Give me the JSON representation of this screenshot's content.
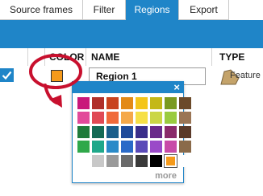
{
  "tabs": [
    {
      "label": "Source frames",
      "active": false
    },
    {
      "label": "Filter",
      "active": false
    },
    {
      "label": "Regions",
      "active": true
    },
    {
      "label": "Export",
      "active": false
    }
  ],
  "grid": {
    "columns": {
      "color": "COLOR",
      "name": "NAME",
      "type": "TYPE"
    },
    "rows": [
      {
        "checked": true,
        "color": "#f59a1b",
        "name": "Region 1",
        "type": "Feature",
        "type_icon": "feature-shape-icon"
      }
    ]
  },
  "color_picker": {
    "close_label": "×",
    "more_label": "more",
    "selected_color": "#f59a1b",
    "colors": [
      "#c9177a",
      "#b0302a",
      "#c8431f",
      "#e38a17",
      "#f4c51a",
      "#c4b817",
      "#7a9a20",
      "#6b4a2a",
      "#e24a9a",
      "#e04a55",
      "#f06a3a",
      "#f5a84a",
      "#f6e047",
      "#cbd646",
      "#9acb3f",
      "#9a7555",
      "#1f7a3a",
      "#146a55",
      "#1a5e8a",
      "#1f4a9a",
      "#3a2e8a",
      "#6a2a8a",
      "#8a2a6a",
      "#5a3a2a",
      "#2fa84a",
      "#1fa88a",
      "#2a8ac8",
      "#2a6ac8",
      "#5a4ab8",
      "#9a4ac8",
      "#c84aa8",
      "#8a6a4a",
      "#ffffff",
      "#c8c8c8",
      "#9a9a9a",
      "#6a6a6a",
      "#3a3a3a",
      "#000000",
      "#f59a1b",
      "#ffffff"
    ]
  },
  "colors": {
    "accent": "#1f85c8",
    "annotation": "#c8102e"
  }
}
